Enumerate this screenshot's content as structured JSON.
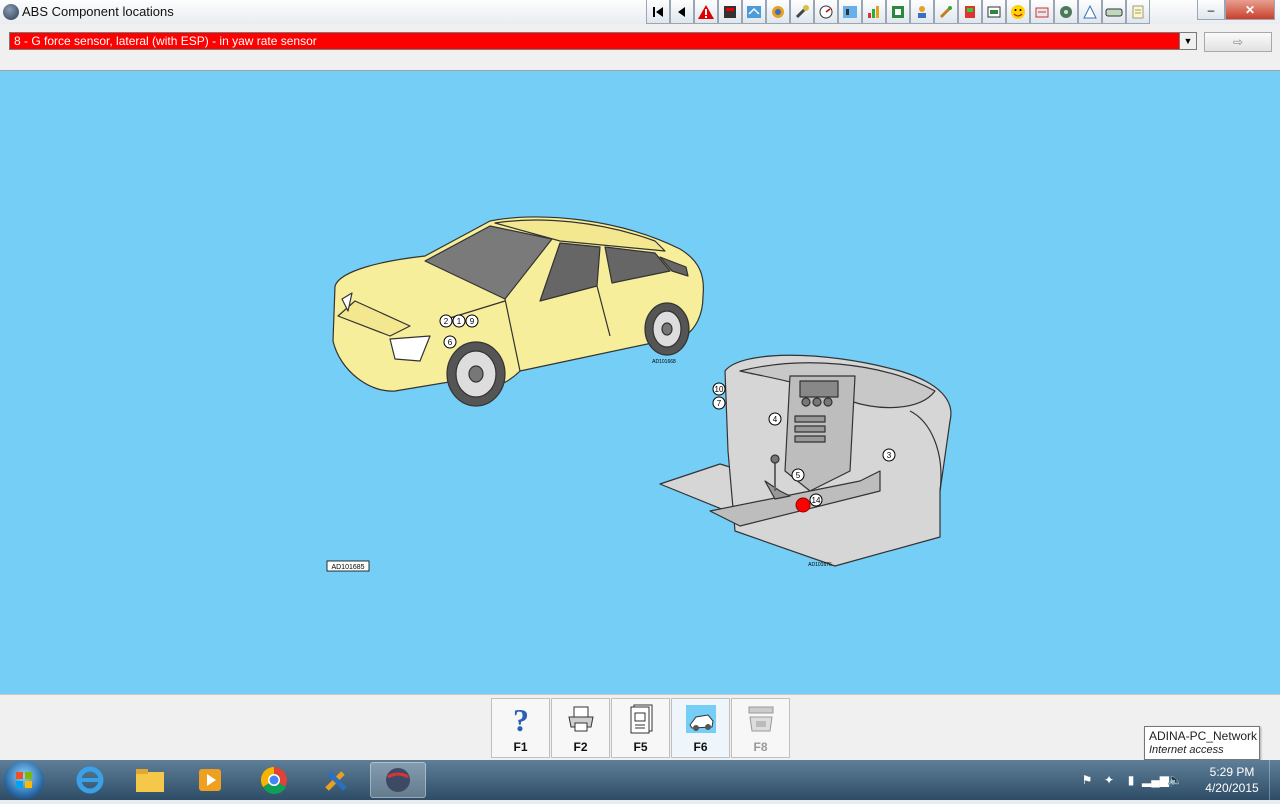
{
  "window": {
    "title": "ABS Component locations",
    "minimize_glyph": "–",
    "maximize_glyph": "□",
    "close_glyph": "✕"
  },
  "toolbar": {
    "icons": [
      "first-page-icon",
      "previous-icon",
      "warning-icon",
      "document-icon",
      "wiring-icon",
      "component-icon",
      "tool-icon",
      "gauge-icon",
      "diagnostic-icon",
      "bar-chart-icon",
      "seat-icon",
      "person-icon",
      "spray-icon",
      "tester-icon",
      "oil-icon",
      "face-icon",
      "puzzle-icon",
      "settings-icon",
      "car-icon",
      "hand-icon",
      "note-icon"
    ]
  },
  "selector": {
    "selected_value": "8 - G force sensor, lateral (with ESP) - in yaw rate sensor",
    "go_button_glyph": "⇨"
  },
  "diagram": {
    "car_ref": "AD101668",
    "interior_ref": "AD101676",
    "figure_ref": "AD101685",
    "car_callouts": [
      "2",
      "1",
      "9",
      "6"
    ],
    "interior_callouts": [
      "10",
      "7",
      "4",
      "3",
      "5",
      "14"
    ],
    "highlighted_callout": "14",
    "colors": {
      "background": "#74cef5",
      "car_body": "#f6ee9a",
      "interior": "#d6d6d6",
      "highlight": "#ff0000"
    }
  },
  "function_keys": [
    {
      "label": "F1",
      "icon": "help-icon"
    },
    {
      "label": "F2",
      "icon": "print-icon"
    },
    {
      "label": "F5",
      "icon": "document-icon"
    },
    {
      "label": "F6",
      "icon": "car-diagram-icon"
    },
    {
      "label": "F8",
      "icon": "device-icon"
    }
  ],
  "tooltip": {
    "network": "ADINA-PC_Network",
    "access": "Internet access"
  },
  "taskbar": {
    "time": "5:29 PM",
    "date": "4/20/2015"
  }
}
